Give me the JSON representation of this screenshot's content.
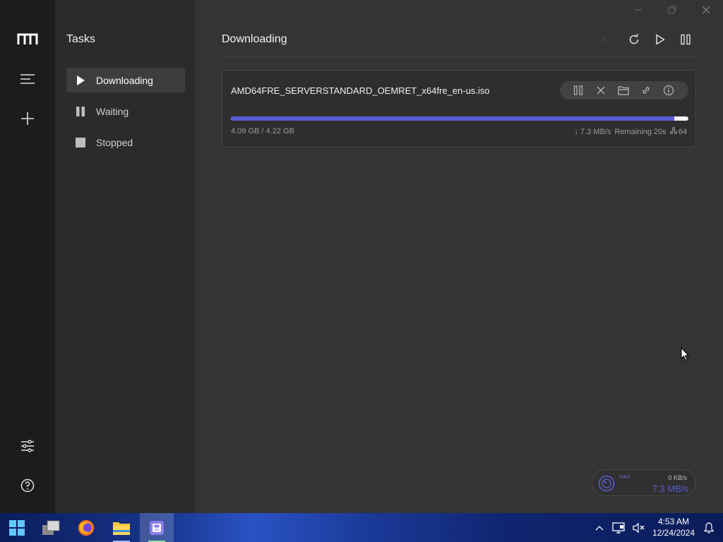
{
  "app": {
    "logo_icon": "motrix-logo-icon",
    "accent_color": "#5b5bd6"
  },
  "rail": {
    "items": [
      {
        "name": "menu",
        "icon": "hamburger-icon"
      },
      {
        "name": "add",
        "icon": "plus-icon"
      },
      {
        "name": "preferences",
        "icon": "sliders-icon"
      },
      {
        "name": "help",
        "icon": "help-circle-icon"
      }
    ]
  },
  "tasks_panel": {
    "title": "Tasks",
    "items": [
      {
        "label": "Downloading",
        "icon": "play-icon",
        "active": true
      },
      {
        "label": "Waiting",
        "icon": "pause-icon",
        "active": false
      },
      {
        "label": "Stopped",
        "icon": "stop-icon",
        "active": false
      }
    ]
  },
  "main": {
    "title": "Downloading",
    "actions": [
      "refresh-icon",
      "play-icon",
      "pause-all-icon"
    ]
  },
  "task": {
    "name": "AMD64FRE_SERVERSTANDARD_OEMRET_x64fre_en-us.iso",
    "progress": 0.969,
    "size_text": "4.09 GB / 4.22 GB",
    "speed": "↓ 7.3 MB/s",
    "remaining": "Remaining 20s",
    "connections": "64",
    "tools": [
      "pause-icon",
      "close-icon",
      "folder-icon",
      "link-icon",
      "info-icon"
    ]
  },
  "speed_widget": {
    "max_label": "MAX",
    "upload": "0 KB/s",
    "download": "7.3 MB/s"
  },
  "taskbar": {
    "time": "4:53 AM",
    "date": "12/24/2024"
  }
}
